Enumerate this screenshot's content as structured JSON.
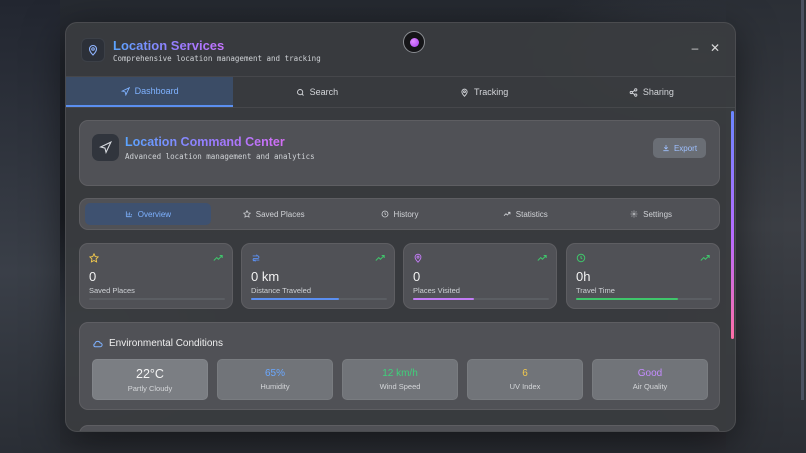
{
  "app": {
    "title": "Location Services",
    "subtitle": "Comprehensive location management and tracking",
    "minimize": "–",
    "close": "✕"
  },
  "tabs": [
    {
      "label": "Dashboard",
      "icon": "navigation-icon",
      "active": true
    },
    {
      "label": "Search",
      "icon": "search-icon",
      "active": false
    },
    {
      "label": "Tracking",
      "icon": "map-pin-icon",
      "active": false
    },
    {
      "label": "Sharing",
      "icon": "share-icon",
      "active": false
    }
  ],
  "command_center": {
    "title": "Location Command Center",
    "subtitle": "Advanced location management and analytics",
    "export_label": "Export"
  },
  "subtabs": [
    {
      "label": "Overview",
      "icon": "bar-chart-icon",
      "active": true
    },
    {
      "label": "Saved Places",
      "icon": "star-icon",
      "active": false
    },
    {
      "label": "History",
      "icon": "clock-icon",
      "active": false
    },
    {
      "label": "Statistics",
      "icon": "trending-up-icon",
      "active": false
    },
    {
      "label": "Settings",
      "icon": "gear-icon",
      "active": false
    }
  ],
  "stats": [
    {
      "value": "0",
      "label": "Saved Places",
      "icon": "star-icon",
      "color": "#f2c94c",
      "progress": 0
    },
    {
      "value": "0 km",
      "label": "Distance Traveled",
      "icon": "route-icon",
      "color": "#5b8ff0",
      "progress": 0.65
    },
    {
      "value": "0",
      "label": "Places Visited",
      "icon": "map-pin-icon",
      "color": "#c27cf5",
      "progress": 0.45
    },
    {
      "value": "0h",
      "label": "Travel Time",
      "icon": "clock-icon",
      "color": "#3fc66b",
      "progress": 0.75
    }
  ],
  "environment": {
    "title": "Environmental Conditions",
    "items": [
      {
        "value": "22°C",
        "label": "Partly Cloudy",
        "color": "#f5f5f5"
      },
      {
        "value": "65%",
        "label": "Humidity",
        "color": "#6aa8ff"
      },
      {
        "value": "12 km/h",
        "label": "Wind Speed",
        "color": "#3fd07a"
      },
      {
        "value": "6",
        "label": "UV Index",
        "color": "#f2c94c"
      },
      {
        "value": "Good",
        "label": "Air Quality",
        "color": "#c48cff"
      }
    ]
  }
}
